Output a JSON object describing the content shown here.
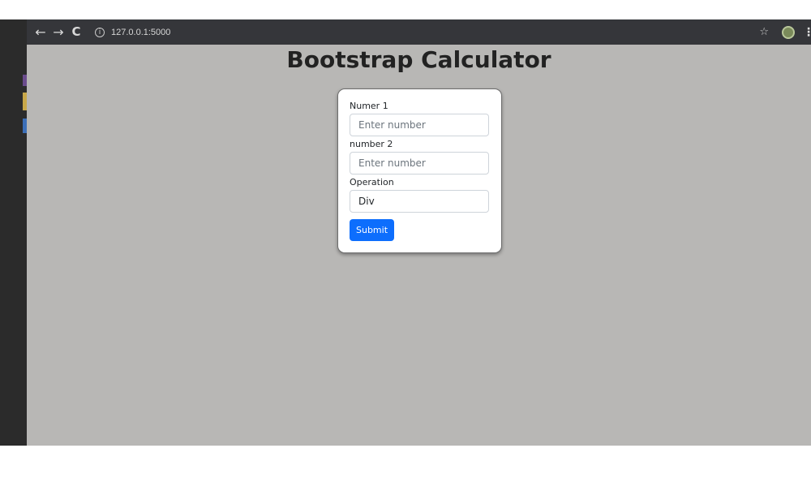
{
  "browser": {
    "url": "127.0.0.1:5000",
    "back_icon": "←",
    "forward_icon": "→",
    "reload_icon": "C",
    "info_icon": "i",
    "star_icon": "☆",
    "menu_icon": "⋮"
  },
  "page": {
    "title": "Bootstrap Calculator"
  },
  "form": {
    "number1": {
      "label": "Numer 1",
      "placeholder": "Enter number",
      "value": ""
    },
    "number2": {
      "label": "number 2",
      "placeholder": "Enter number",
      "value": ""
    },
    "operation": {
      "label": "Operation",
      "selected": "Div"
    },
    "submit_label": "Submit"
  },
  "colors": {
    "page_background": "#b8b7b5",
    "browser_bar": "#35363a",
    "primary_button": "#0d6efd"
  }
}
